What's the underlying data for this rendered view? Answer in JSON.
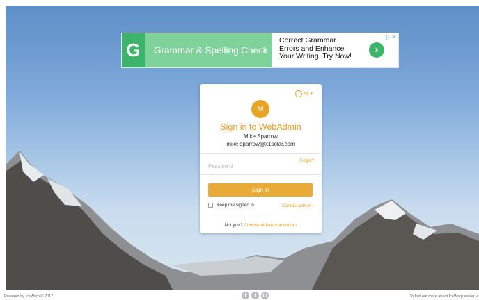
{
  "ad": {
    "logo_letter": "G",
    "title": "Grammar & Spelling Check",
    "copy_line1": "Correct Grammar",
    "copy_line2": "Errors and Enhance",
    "copy_line3": "Your Writing. Try Now!",
    "arrow": "›",
    "choices": "▷✕"
  },
  "login": {
    "language": "All",
    "avatar_letter": "M",
    "title": "Sign in to WebAdmin",
    "user_name": "Mike Sparrow",
    "user_email": "mike.sparrow@x1solar.com",
    "password_placeholder": "Password",
    "forgot_label": "Forgot?",
    "signin_label": "Sign in",
    "keep_signed_in_label": "Keep me signed in",
    "contact_admin_label": "Contact admin ›",
    "not_you_label": "Not you?",
    "choose_account_label": "Choose different account ›"
  },
  "footer": {
    "copyright": "Powered by IceWarp © 2017",
    "info": "To find out more about IceWarp server v",
    "social": [
      "f",
      "t",
      "in"
    ]
  },
  "colors": {
    "accent": "#e8a020",
    "button": "#e8ab37",
    "ad_green": "#7fd39a"
  }
}
